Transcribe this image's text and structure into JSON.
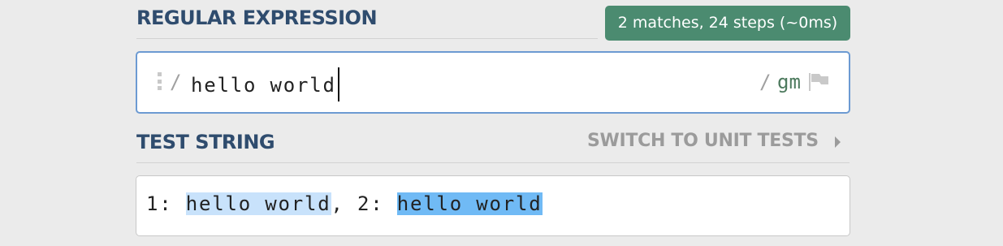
{
  "regex_section": {
    "title": "REGULAR EXPRESSION",
    "status": "2 matches, 24 steps (~0ms)",
    "delimiter_open": "/",
    "pattern": "hello world",
    "delimiter_close": "/",
    "flags": "gm",
    "flag_icon": "flag-icon"
  },
  "test_section": {
    "title": "TEST STRING",
    "switch_label": "SWITCH TO UNIT TESTS",
    "switch_icon": "triangle-right-icon",
    "segments": {
      "prefix_1": "1: ",
      "match_1": "hello world",
      "prefix_2": ", 2: ",
      "match_2": "hello world"
    }
  },
  "colors": {
    "heading": "#2f4c6e",
    "status_badge": "#4b8b70",
    "input_border": "#6c9ad2",
    "flags": "#4d7a5e",
    "match_highlight_1": "#c8e2fb",
    "match_highlight_2": "#70baf5",
    "link_muted": "#9b9b9b"
  }
}
